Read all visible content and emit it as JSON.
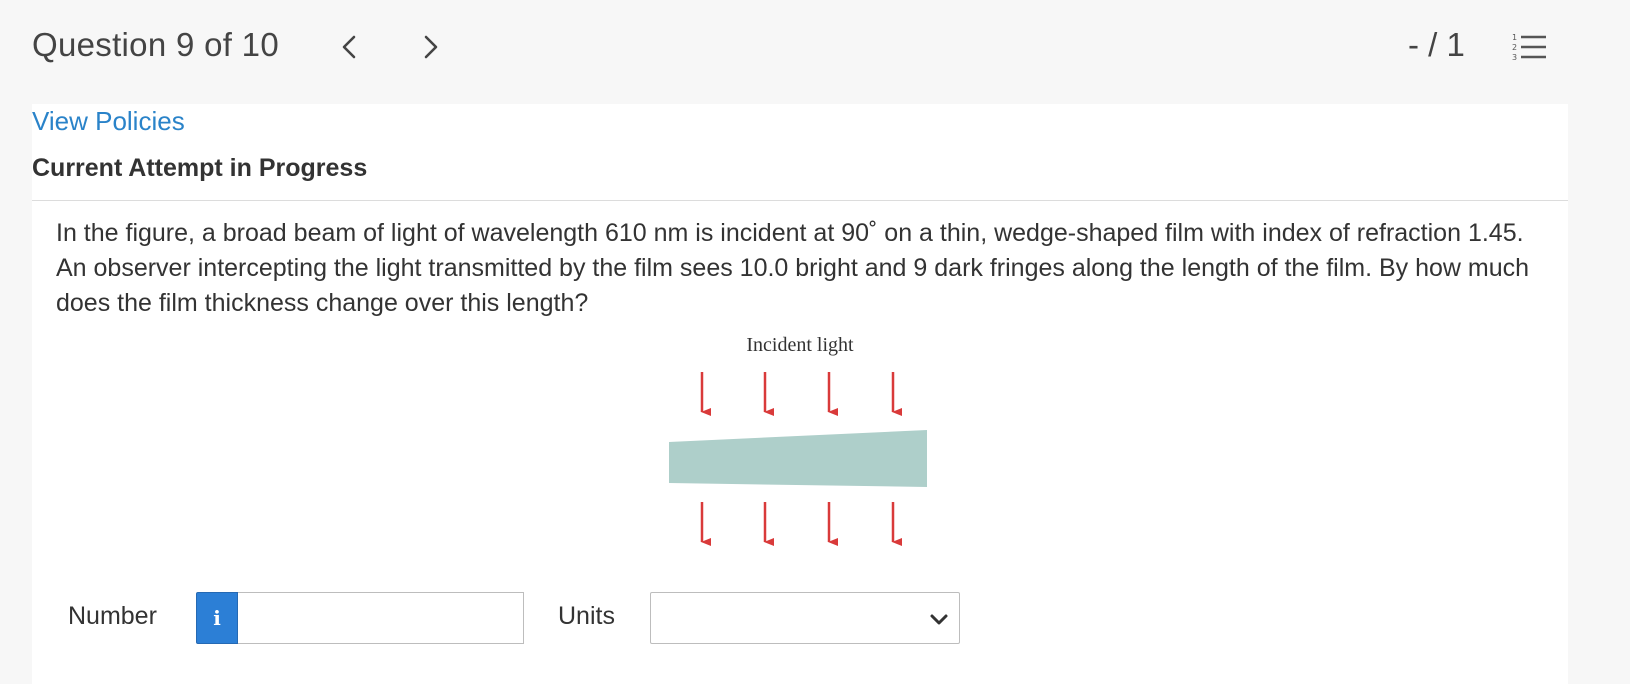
{
  "header": {
    "question_counter": "Question 9 of 10",
    "score": "- / 1",
    "prev_icon": "chevron-left-icon",
    "next_icon": "chevron-right-icon",
    "list_icon": "numbered-list-icon"
  },
  "links": {
    "view_policies": "View Policies"
  },
  "attempt_status": "Current Attempt in Progress",
  "question": {
    "text": "In the figure, a broad beam of light of wavelength 610 nm is incident at 90˚ on a thin, wedge-shaped film with index of refraction 1.45. An observer intercepting the light transmitted by the film sees 10.0 bright and 9 dark fringes along the length of the film. By how much does the film thickness change over this length?"
  },
  "figure": {
    "label": "Incident light",
    "arrow_color": "#d93a3a",
    "film_color": "#aecfca"
  },
  "answer": {
    "number_label": "Number",
    "number_value": "",
    "info_icon": "info-icon",
    "units_label": "Units",
    "units_value": ""
  },
  "colors": {
    "link": "#2a83c9",
    "info_button": "#2c7fd6",
    "background": "#f7f7f7"
  }
}
